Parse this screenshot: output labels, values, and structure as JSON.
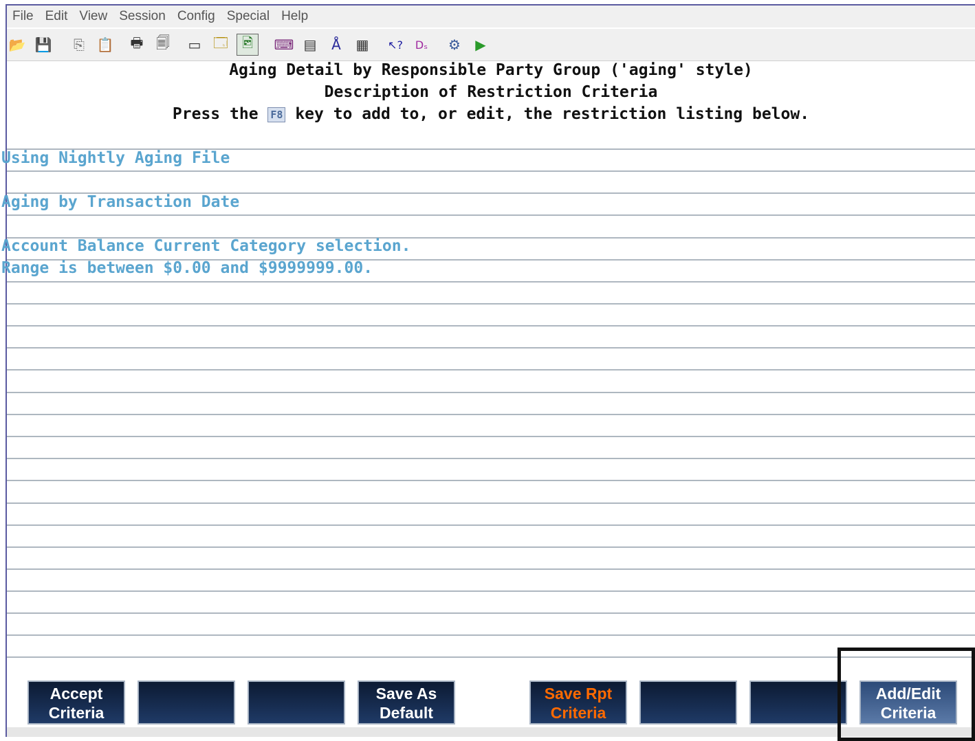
{
  "menu": [
    "File",
    "Edit",
    "View",
    "Session",
    "Config",
    "Special",
    "Help"
  ],
  "toolbar_icons": [
    {
      "name": "open-folder-icon",
      "glyph": "📂"
    },
    {
      "name": "save-disk-icon",
      "glyph": "💾"
    },
    {
      "name": "copy-icon",
      "glyph": "⎘"
    },
    {
      "name": "paste-icon",
      "glyph": "📋"
    },
    {
      "name": "print-icon",
      "glyph": "🖶"
    },
    {
      "name": "print-setup-icon",
      "glyph": "🗐"
    },
    {
      "name": "screen-capture-icon",
      "glyph": "▭"
    },
    {
      "name": "info-window-icon",
      "glyph": "🗔"
    },
    {
      "name": "image-toggle-icon",
      "glyph": "🖻"
    },
    {
      "name": "keyboard-map-icon",
      "glyph": "⌨"
    },
    {
      "name": "edit-box-icon",
      "glyph": "▤"
    },
    {
      "name": "font-icon",
      "glyph": "Å"
    },
    {
      "name": "grid-icon",
      "glyph": "▦"
    },
    {
      "name": "help-pointer-icon",
      "glyph": "↖?"
    },
    {
      "name": "docs-icon",
      "glyph": "Dₛ"
    },
    {
      "name": "network-icon",
      "glyph": "⚙"
    },
    {
      "name": "play-icon",
      "glyph": "▶"
    }
  ],
  "header": {
    "line1": "Aging Detail by Responsible Party Group ('aging' style)",
    "line2": "Description of Restriction Criteria",
    "line3_prefix": "Press the ",
    "f8_key": "F8",
    "line3_suffix": " key to add to, or edit, the restriction listing below."
  },
  "criteria": [
    "Using Nightly Aging File",
    "",
    "Aging by Transaction Date",
    "",
    "Account Balance Current Category selection.",
    "Range is between $0.00 and $9999999.00."
  ],
  "function_keys": [
    {
      "label1": "Accept",
      "label2": "Criteria"
    },
    {
      "label1": "",
      "label2": ""
    },
    {
      "label1": "",
      "label2": ""
    },
    {
      "label1": "Save As",
      "label2": "Default"
    },
    {
      "label1": "Save Rpt",
      "label2": "Criteria"
    },
    {
      "label1": "",
      "label2": ""
    },
    {
      "label1": "",
      "label2": ""
    },
    {
      "label1": "Add/Edit",
      "label2": "Criteria"
    }
  ],
  "colors": {
    "criteria_text": "#5aa5cf",
    "fkey_orange": "#ff6a00",
    "fkey_bg": "#0c1a33"
  }
}
